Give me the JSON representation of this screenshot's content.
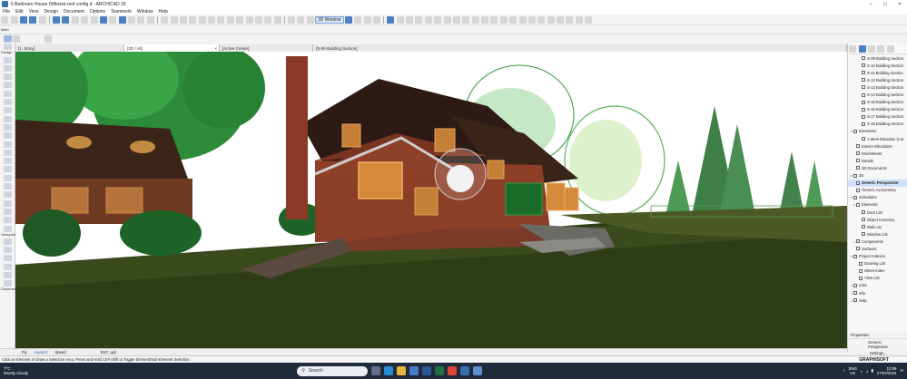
{
  "window": {
    "title": "6 Bedroom House Different.roof config d - ARCHICAD 25"
  },
  "menu": [
    "File",
    "Edit",
    "View",
    "Design",
    "Document",
    "Options",
    "Teamwork",
    "Window",
    "Help"
  ],
  "toolbar": {
    "window_3d_label": "3D Window"
  },
  "toolbox": {
    "main_label": "Main",
    "design_label": "Design",
    "viewpoint_label": "Viewpoint",
    "document_label": "Documen"
  },
  "tabs": [
    {
      "label": "[1. Story]"
    },
    {
      "label": "[3D / All]"
    },
    {
      "label": "[Active Center]"
    },
    {
      "label": "[S-06 Building Section]"
    }
  ],
  "navigator": {
    "items": [
      {
        "label": "S-09 Building Section"
      },
      {
        "label": "S-10 Building Section"
      },
      {
        "label": "S-11 Building Section"
      },
      {
        "label": "S-12 Building Section"
      },
      {
        "label": "S-13 Building Section"
      },
      {
        "label": "S-14 Building Section"
      },
      {
        "label": "S-15 Building Section"
      },
      {
        "label": "S-16 Building Section"
      },
      {
        "label": "S-17 Building Section"
      },
      {
        "label": "S-18 Building Section"
      },
      {
        "label": "Elevations"
      },
      {
        "label": "1 West Elevation (Aut"
      },
      {
        "label": "Interior Elevations"
      },
      {
        "label": "Worksheets"
      },
      {
        "label": "Details"
      },
      {
        "label": "3D Documents"
      },
      {
        "label": "3D"
      },
      {
        "label": "Generic Perspective"
      },
      {
        "label": "Generic Axonometry"
      },
      {
        "label": "Schedules"
      },
      {
        "label": "Elements"
      },
      {
        "label": "Door List"
      },
      {
        "label": "Object Inventory"
      },
      {
        "label": "Wall List"
      },
      {
        "label": "Window List"
      },
      {
        "label": "Components"
      },
      {
        "label": "Surfaces"
      },
      {
        "label": "Project Indexes"
      },
      {
        "label": "Drawing List"
      },
      {
        "label": "Sheet Index"
      },
      {
        "label": "View List"
      },
      {
        "label": "Lists"
      },
      {
        "label": "Info"
      },
      {
        "label": "Help"
      }
    ]
  },
  "properties": {
    "header": "Properties",
    "value": "Generic Perspective",
    "settings": "Settings..."
  },
  "status": {
    "fly": "Fly",
    "joystick": "Joystick",
    "speed": "Speed",
    "esc": "ESC: quit"
  },
  "hint": "Click an Element or Draw a Selection Area. Press and Hold Ctrl+Shift to Toggle Element/Sub-Element Selection.",
  "brand": "GRAPHISOFT",
  "taskbar": {
    "temperature": "7°C",
    "weather": "Mostly cloudy",
    "search_placeholder": "Search",
    "lang1": "ENG",
    "lang2": "UK",
    "time": "12:09",
    "date": "27/02/2024"
  }
}
